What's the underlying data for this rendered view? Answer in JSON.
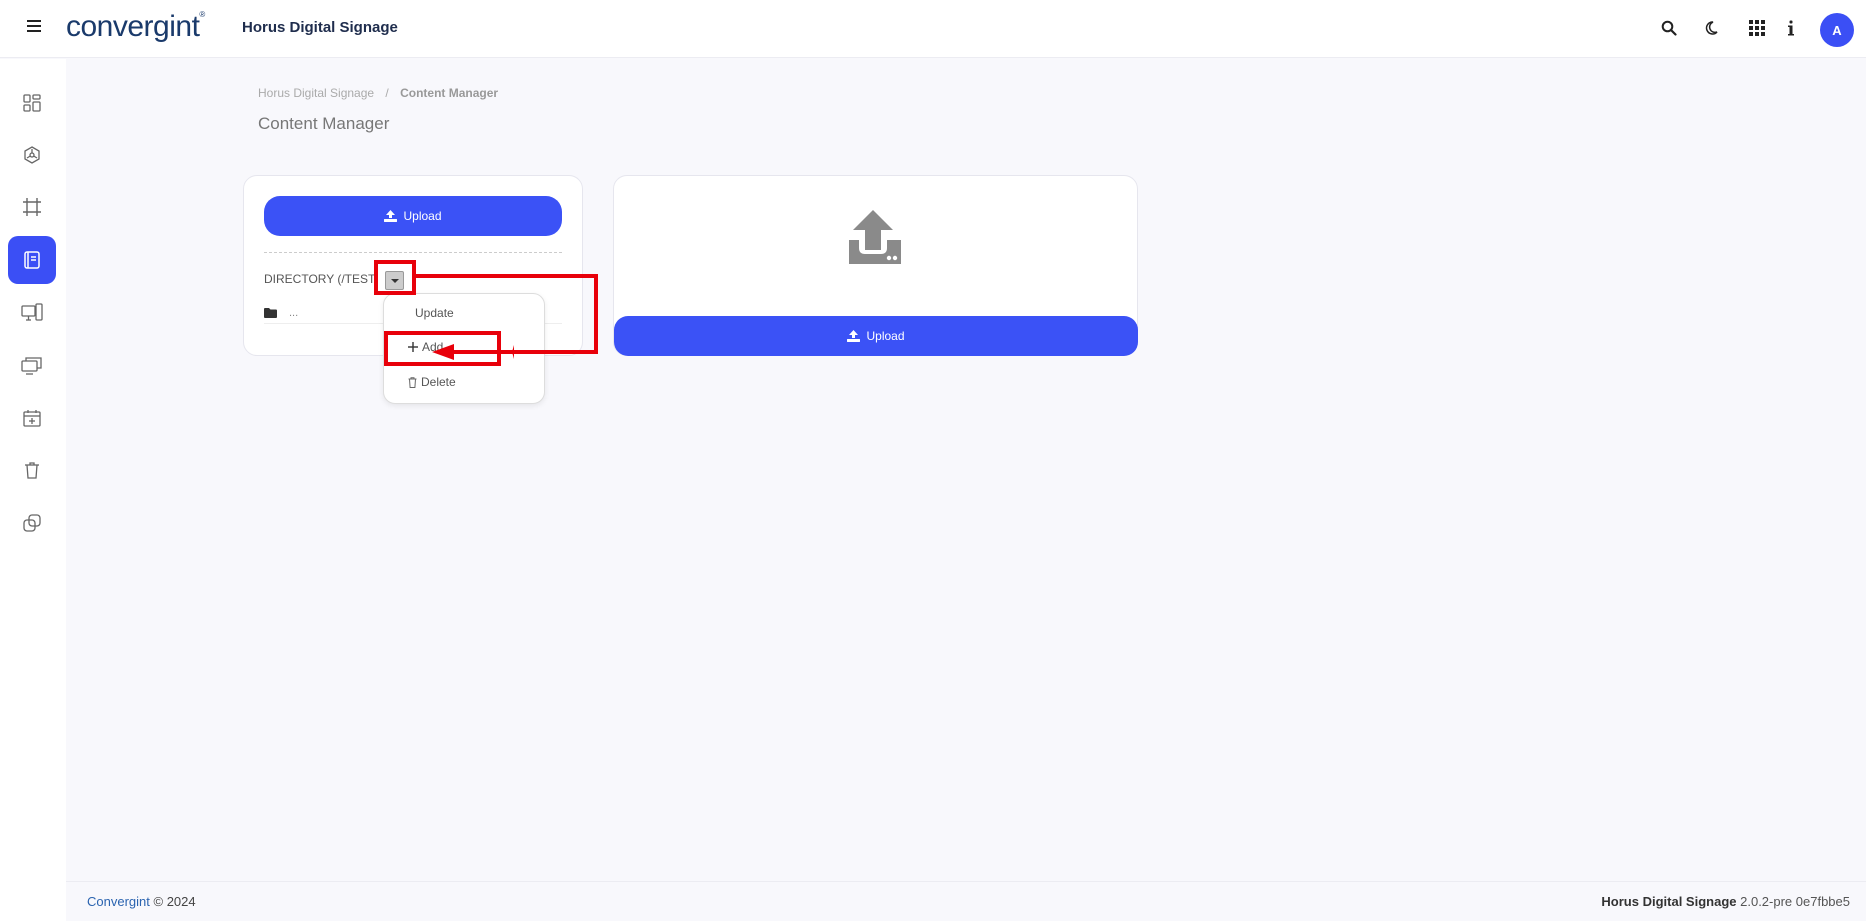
{
  "header": {
    "logo_text": "convergint",
    "app_title": "Horus Digital Signage",
    "avatar_initial": "A",
    "icons": [
      "search-icon",
      "moon-icon",
      "apps-grid-icon",
      "info-icon"
    ]
  },
  "sidebar": {
    "items": [
      {
        "icon": "dashboard-icon",
        "active": false
      },
      {
        "icon": "network-icon",
        "active": false
      },
      {
        "icon": "frame-icon",
        "active": false
      },
      {
        "icon": "content-manager-icon",
        "active": true
      },
      {
        "icon": "devices-icon",
        "active": false
      },
      {
        "icon": "displays-icon",
        "active": false
      },
      {
        "icon": "calendar-add-icon",
        "active": false
      },
      {
        "icon": "trash-icon",
        "active": false
      },
      {
        "icon": "copy-icon",
        "active": false
      }
    ]
  },
  "breadcrumb": {
    "root": "Horus Digital Signage",
    "separator": "/",
    "current": "Content Manager"
  },
  "page": {
    "title": "Content Manager"
  },
  "left_card": {
    "upload_label": "Upload",
    "directory_label": "DIRECTORY (/TEST",
    "folder_name": "..."
  },
  "dropdown": {
    "update_label": "Update",
    "add_label": "Add",
    "delete_label": "Delete"
  },
  "right_card": {
    "upload_label": "Upload"
  },
  "footer": {
    "brand": "Convergint",
    "copyright": "© 2024",
    "app_name": "Horus Digital Signage",
    "version": "2.0.2-pre 0e7fbbe5"
  },
  "colors": {
    "accent": "#3b52f6",
    "annotation": "#e8000a"
  }
}
